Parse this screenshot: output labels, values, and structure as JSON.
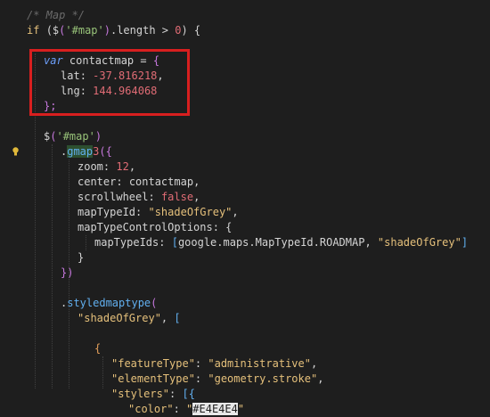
{
  "editor": {
    "line_height": 17,
    "lines": [
      {
        "indent": 0,
        "tokens": [
          {
            "t": "/* Map */",
            "c": "c-comment"
          }
        ]
      },
      {
        "indent": 0,
        "tokens": [
          {
            "t": "if ",
            "c": "c-kw"
          },
          {
            "t": "(",
            "c": "c-paren1"
          },
          {
            "t": "$",
            "c": "c-plain"
          },
          {
            "t": "(",
            "c": "c-paren2"
          },
          {
            "t": "'#map'",
            "c": "c-str"
          },
          {
            "t": ")",
            "c": "c-paren2"
          },
          {
            "t": ".length ",
            "c": "c-prop"
          },
          {
            "t": "> ",
            "c": "c-op"
          },
          {
            "t": "0",
            "c": "c-num"
          },
          {
            "t": ") {",
            "c": "c-paren1"
          }
        ]
      },
      {
        "indent": 0,
        "tokens": []
      },
      {
        "indent": 1,
        "tokens": [
          {
            "t": "var ",
            "c": "c-kw-storage"
          },
          {
            "t": "contactmap ",
            "c": "c-plain"
          },
          {
            "t": "= ",
            "c": "c-op"
          },
          {
            "t": "{",
            "c": "c-brace"
          }
        ]
      },
      {
        "indent": 2,
        "tokens": [
          {
            "t": "lat",
            "c": "c-plain"
          },
          {
            "t": ": ",
            "c": "c-punc"
          },
          {
            "t": "-37.816218",
            "c": "c-num"
          },
          {
            "t": ",",
            "c": "c-punc"
          }
        ]
      },
      {
        "indent": 2,
        "tokens": [
          {
            "t": "lng",
            "c": "c-plain"
          },
          {
            "t": ": ",
            "c": "c-punc"
          },
          {
            "t": "144.964068",
            "c": "c-num"
          }
        ]
      },
      {
        "indent": 1,
        "tokens": [
          {
            "t": "};",
            "c": "c-brace"
          }
        ]
      },
      {
        "indent": 0,
        "tokens": []
      },
      {
        "indent": 1,
        "tokens": [
          {
            "t": "$",
            "c": "c-plain"
          },
          {
            "t": "(",
            "c": "c-paren2"
          },
          {
            "t": "'#map'",
            "c": "c-str"
          },
          {
            "t": ")",
            "c": "c-paren2"
          }
        ]
      },
      {
        "indent": 2,
        "bulb": true,
        "tokens": [
          {
            "t": ".",
            "c": "c-punc"
          },
          {
            "t": "gmap",
            "c": "c-fn",
            "match": true
          },
          {
            "t": "3",
            "c": "c-num"
          },
          {
            "t": "({",
            "c": "c-brace"
          }
        ]
      },
      {
        "indent": 3,
        "tokens": [
          {
            "t": "zoom",
            "c": "c-plain"
          },
          {
            "t": ": ",
            "c": "c-punc"
          },
          {
            "t": "12",
            "c": "c-num"
          },
          {
            "t": ",",
            "c": "c-punc"
          }
        ]
      },
      {
        "indent": 3,
        "tokens": [
          {
            "t": "center",
            "c": "c-plain"
          },
          {
            "t": ": ",
            "c": "c-punc"
          },
          {
            "t": "contactmap",
            "c": "c-plain"
          },
          {
            "t": ",",
            "c": "c-punc"
          }
        ]
      },
      {
        "indent": 3,
        "tokens": [
          {
            "t": "scrollwheel",
            "c": "c-plain"
          },
          {
            "t": ": ",
            "c": "c-punc"
          },
          {
            "t": "false",
            "c": "c-bool"
          },
          {
            "t": ",",
            "c": "c-punc"
          }
        ]
      },
      {
        "indent": 3,
        "tokens": [
          {
            "t": "mapTypeId",
            "c": "c-plain"
          },
          {
            "t": ": ",
            "c": "c-punc"
          },
          {
            "t": "\"shadeOfGrey\"",
            "c": "c-strq"
          },
          {
            "t": ",",
            "c": "c-punc"
          }
        ]
      },
      {
        "indent": 3,
        "tokens": [
          {
            "t": "mapTypeControlOptions",
            "c": "c-plain"
          },
          {
            "t": ": ",
            "c": "c-punc"
          },
          {
            "t": "{",
            "c": "c-punc"
          }
        ]
      },
      {
        "indent": 4,
        "tokens": [
          {
            "t": "mapTypeIds",
            "c": "c-plain"
          },
          {
            "t": ": ",
            "c": "c-punc"
          },
          {
            "t": "[",
            "c": "c-bracket"
          },
          {
            "t": "google.maps.MapTypeId.ROADMAP",
            "c": "c-plain"
          },
          {
            "t": ", ",
            "c": "c-punc"
          },
          {
            "t": "\"shadeOfGrey\"",
            "c": "c-strq"
          },
          {
            "t": "]",
            "c": "c-bracket"
          }
        ]
      },
      {
        "indent": 3,
        "tokens": [
          {
            "t": "}",
            "c": "c-punc"
          }
        ]
      },
      {
        "indent": 2,
        "tokens": [
          {
            "t": "})",
            "c": "c-brace"
          }
        ]
      },
      {
        "indent": 0,
        "tokens": []
      },
      {
        "indent": 2,
        "tokens": [
          {
            "t": ".",
            "c": "c-punc"
          },
          {
            "t": "styledmaptype",
            "c": "c-fn"
          },
          {
            "t": "(",
            "c": "c-paren2"
          }
        ]
      },
      {
        "indent": 3,
        "tokens": [
          {
            "t": "\"shadeOfGrey\"",
            "c": "c-strq"
          },
          {
            "t": ", ",
            "c": "c-punc"
          },
          {
            "t": "[",
            "c": "c-bracket"
          }
        ]
      },
      {
        "indent": 0,
        "tokens": []
      },
      {
        "indent": 4,
        "tokens": [
          {
            "t": "{",
            "c": "c-orange"
          }
        ]
      },
      {
        "indent": 5,
        "tokens": [
          {
            "t": "\"featureType\"",
            "c": "c-key"
          },
          {
            "t": ": ",
            "c": "c-punc"
          },
          {
            "t": "\"administrative\"",
            "c": "c-strq"
          },
          {
            "t": ",",
            "c": "c-punc"
          }
        ]
      },
      {
        "indent": 5,
        "tokens": [
          {
            "t": "\"elementType\"",
            "c": "c-key"
          },
          {
            "t": ": ",
            "c": "c-punc"
          },
          {
            "t": "\"geometry.stroke\"",
            "c": "c-strq"
          },
          {
            "t": ",",
            "c": "c-punc"
          }
        ]
      },
      {
        "indent": 5,
        "tokens": [
          {
            "t": "\"stylers\"",
            "c": "c-key"
          },
          {
            "t": ": ",
            "c": "c-punc"
          },
          {
            "t": "[{",
            "c": "c-bracket"
          }
        ]
      },
      {
        "indent": 6,
        "tokens": [
          {
            "t": "\"color\"",
            "c": "c-key"
          },
          {
            "t": ": ",
            "c": "c-punc"
          },
          {
            "t": "\"",
            "c": "c-strq"
          },
          {
            "t": "#E4E4E4",
            "c": "c-plain",
            "selected": true
          },
          {
            "t": "\"",
            "c": "c-strq"
          }
        ]
      }
    ]
  }
}
